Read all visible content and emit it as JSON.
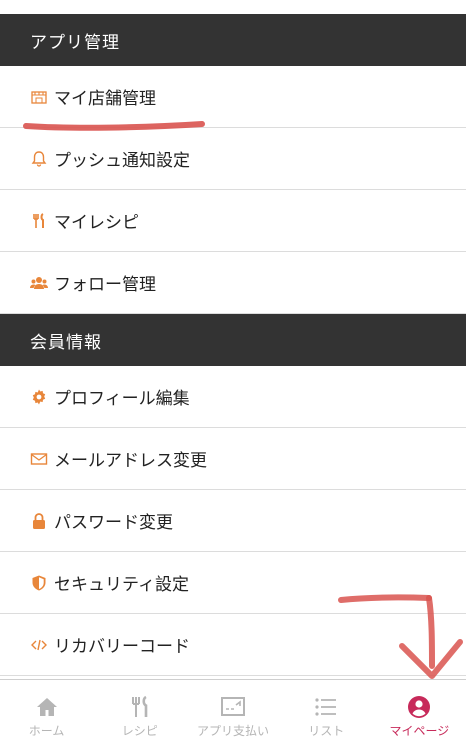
{
  "sections": [
    {
      "title": "アプリ管理",
      "items": [
        {
          "label": "マイ店舗管理",
          "icon": "store-icon"
        },
        {
          "label": "プッシュ通知設定",
          "icon": "bell-icon"
        },
        {
          "label": "マイレシピ",
          "icon": "fork-knife-icon"
        },
        {
          "label": "フォロー管理",
          "icon": "users-icon"
        }
      ]
    },
    {
      "title": "会員情報",
      "items": [
        {
          "label": "プロフィール編集",
          "icon": "gear-icon"
        },
        {
          "label": "メールアドレス変更",
          "icon": "envelope-icon"
        },
        {
          "label": "パスワード変更",
          "icon": "lock-icon"
        },
        {
          "label": "セキュリティ設定",
          "icon": "shield-icon"
        },
        {
          "label": "リカバリーコード",
          "icon": "code-icon"
        }
      ]
    }
  ],
  "bottom_nav": [
    {
      "label": "ホーム",
      "icon": "home-icon",
      "active": false
    },
    {
      "label": "レシピ",
      "icon": "fork-knife-icon",
      "active": false
    },
    {
      "label": "アプリ支払い",
      "icon": "payment-icon",
      "active": false
    },
    {
      "label": "リスト",
      "icon": "list-icon",
      "active": false
    },
    {
      "label": "マイページ",
      "icon": "user-circle-icon",
      "active": true
    }
  ],
  "colors": {
    "header_bg": "#333333",
    "accent_orange": "#e8863a",
    "active_nav": "#c72a5a",
    "inactive_nav": "#b5b5b5",
    "annotation_red": "#d9534f"
  }
}
